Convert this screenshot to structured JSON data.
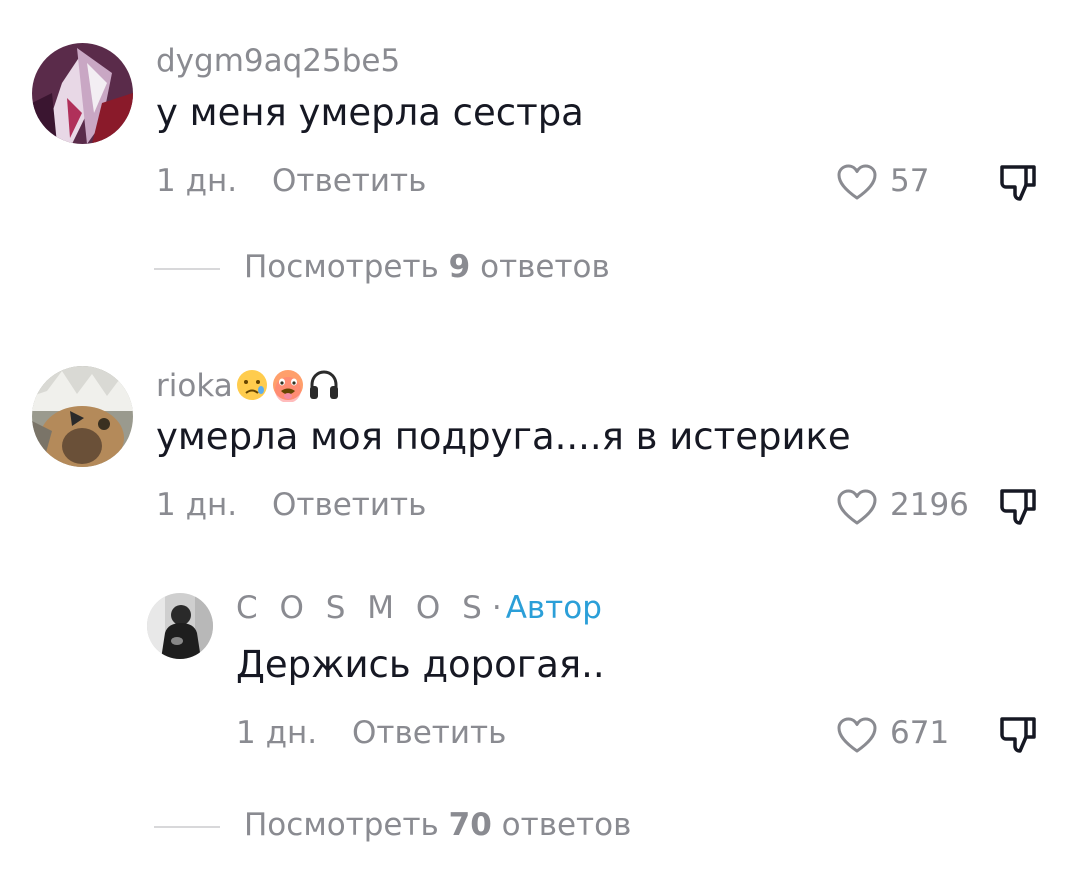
{
  "comments": [
    {
      "username": "dygm9aq25be5",
      "text": "у меня умерла сестра",
      "time": "1 дн.",
      "reply_label": "Ответить",
      "likes": "57",
      "view_replies": {
        "prefix": "Посмотреть",
        "count": "9",
        "suffix": "ответов"
      }
    },
    {
      "username": "rioka",
      "username_icons": [
        "slightly-frowning-emoji-icon",
        "hot-face-emoji-icon",
        "headphones-icon"
      ],
      "text": "умерла моя подруга....я в истерике",
      "time": "1 дн.",
      "reply_label": "Ответить",
      "likes": "2196"
    }
  ],
  "reply": {
    "username": "C O S M O S",
    "separator": "·",
    "author_badge": "Автор",
    "text": "Держись дорогая..",
    "time": "1 дн.",
    "reply_label": "Ответить",
    "likes": "671",
    "view_replies": {
      "prefix": "Посмотреть",
      "count": "70",
      "suffix": "ответов"
    }
  },
  "colors": {
    "text_primary": "#161823",
    "text_secondary": "#8a8b91",
    "author_accent": "#2b9fd8",
    "divider": "#d8d8da"
  }
}
